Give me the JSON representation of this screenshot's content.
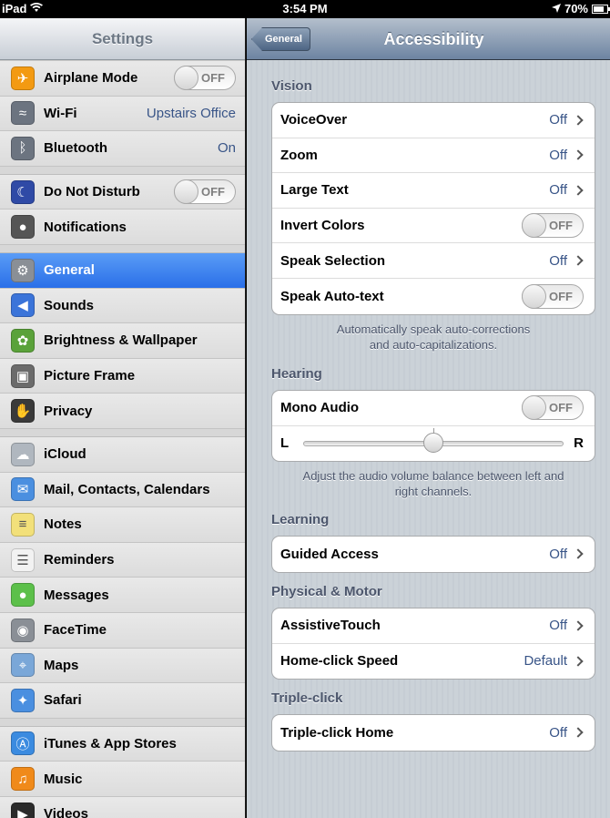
{
  "status": {
    "device": "iPad",
    "time": "3:54 PM",
    "battery": "70%",
    "battery_level": 0.7
  },
  "sidebar": {
    "title": "Settings",
    "groups": [
      [
        {
          "label": "Airplane Mode",
          "icon": "airplane-icon",
          "toggle": "OFF"
        },
        {
          "label": "Wi-Fi",
          "icon": "wifi-icon",
          "value": "Upstairs Office"
        },
        {
          "label": "Bluetooth",
          "icon": "bluetooth-icon",
          "value": "On"
        }
      ],
      [
        {
          "label": "Do Not Disturb",
          "icon": "moon-icon",
          "toggle": "OFF"
        },
        {
          "label": "Notifications",
          "icon": "notifications-icon"
        }
      ],
      [
        {
          "label": "General",
          "icon": "gear-icon",
          "selected": true
        },
        {
          "label": "Sounds",
          "icon": "speaker-icon"
        },
        {
          "label": "Brightness & Wallpaper",
          "icon": "flower-icon"
        },
        {
          "label": "Picture Frame",
          "icon": "picture-frame-icon"
        },
        {
          "label": "Privacy",
          "icon": "hand-icon"
        }
      ],
      [
        {
          "label": "iCloud",
          "icon": "cloud-icon"
        },
        {
          "label": "Mail, Contacts, Calendars",
          "icon": "mail-icon"
        },
        {
          "label": "Notes",
          "icon": "notes-icon"
        },
        {
          "label": "Reminders",
          "icon": "reminders-icon"
        },
        {
          "label": "Messages",
          "icon": "messages-icon"
        },
        {
          "label": "FaceTime",
          "icon": "facetime-icon"
        },
        {
          "label": "Maps",
          "icon": "maps-icon"
        },
        {
          "label": "Safari",
          "icon": "safari-icon"
        }
      ],
      [
        {
          "label": "iTunes & App Stores",
          "icon": "appstore-icon"
        },
        {
          "label": "Music",
          "icon": "music-icon"
        },
        {
          "label": "Videos",
          "icon": "videos-icon"
        }
      ]
    ]
  },
  "detail": {
    "back_label": "General",
    "title": "Accessibility",
    "vision": {
      "title": "Vision",
      "rows": [
        {
          "label": "VoiceOver",
          "value": "Off"
        },
        {
          "label": "Zoom",
          "value": "Off"
        },
        {
          "label": "Large Text",
          "value": "Off"
        },
        {
          "label": "Invert Colors",
          "toggle": "OFF"
        },
        {
          "label": "Speak Selection",
          "value": "Off"
        },
        {
          "label": "Speak Auto-text",
          "toggle": "OFF"
        }
      ],
      "footnote_1": "Automatically speak auto-corrections",
      "footnote_2": "and auto-capitalizations."
    },
    "hearing": {
      "title": "Hearing",
      "mono_label": "Mono Audio",
      "mono_toggle": "OFF",
      "left_label": "L",
      "right_label": "R",
      "balance": 0.5,
      "footnote_1": "Adjust the audio volume balance between left and",
      "footnote_2": "right channels."
    },
    "learning": {
      "title": "Learning",
      "rows": [
        {
          "label": "Guided Access",
          "value": "Off"
        }
      ]
    },
    "physical": {
      "title": "Physical & Motor",
      "rows": [
        {
          "label": "AssistiveTouch",
          "value": "Off"
        },
        {
          "label": "Home-click Speed",
          "value": "Default"
        }
      ]
    },
    "triple": {
      "title": "Triple-click",
      "rows": [
        {
          "label": "Triple-click Home",
          "value": "Off"
        }
      ]
    }
  },
  "colors": {
    "selected_row": "#2a6fe8",
    "value_text": "#385487",
    "section_title": "#4c566c"
  }
}
